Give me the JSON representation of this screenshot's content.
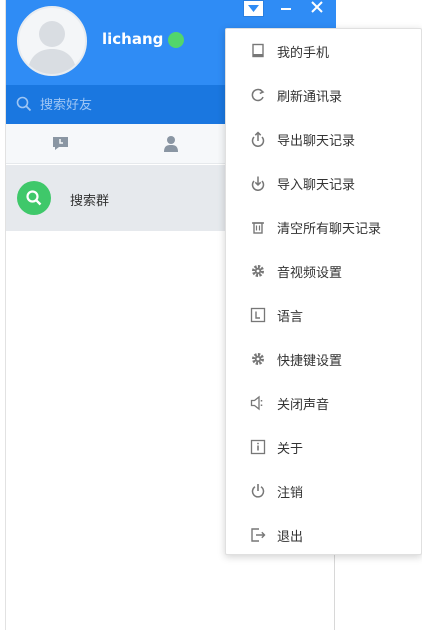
{
  "profile": {
    "username": "lichang",
    "status": "online"
  },
  "search": {
    "placeholder": "搜索好友"
  },
  "tabs": [
    {
      "icon": "chat-icon"
    },
    {
      "icon": "contacts-icon"
    }
  ],
  "group_search": {
    "label": "搜索群"
  },
  "menu": {
    "items": [
      {
        "label": "我的手机",
        "icon": "phone-icon"
      },
      {
        "label": "刷新通讯录",
        "icon": "refresh-icon"
      },
      {
        "label": "导出聊天记录",
        "icon": "export-icon"
      },
      {
        "label": "导入聊天记录",
        "icon": "import-icon"
      },
      {
        "label": "清空所有聊天记录",
        "icon": "trash-icon"
      },
      {
        "label": "音视频设置",
        "icon": "gear-icon"
      },
      {
        "label": "语言",
        "icon": "language-icon"
      },
      {
        "label": "快捷键设置",
        "icon": "gear-icon"
      },
      {
        "label": "关闭声音",
        "icon": "mute-icon"
      },
      {
        "label": "关于",
        "icon": "info-icon"
      },
      {
        "label": "注销",
        "icon": "power-icon"
      },
      {
        "label": "退出",
        "icon": "exit-icon"
      }
    ]
  },
  "colors": {
    "brand_blue": "#2f8cf5",
    "search_blue": "#1a77e0",
    "online_green": "#52d66b",
    "group_green": "#3fc86a"
  }
}
